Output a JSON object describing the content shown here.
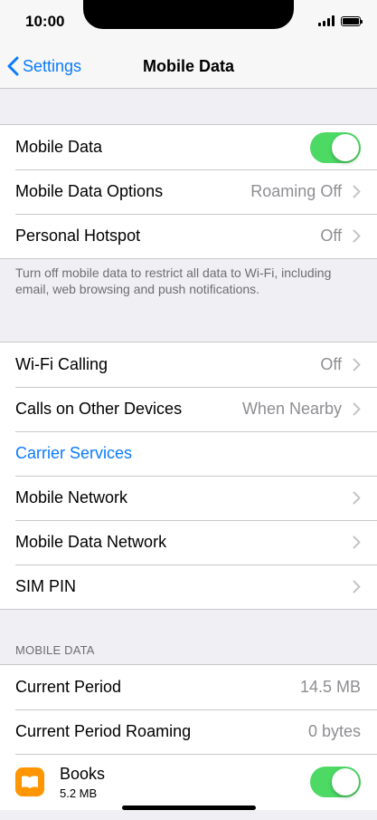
{
  "status_bar": {
    "time": "10:00"
  },
  "nav": {
    "back_label": "Settings",
    "title": "Mobile Data"
  },
  "group1": {
    "mobile_data_label": "Mobile Data",
    "mobile_data_on": true,
    "options_label": "Mobile Data Options",
    "options_value": "Roaming Off",
    "hotspot_label": "Personal Hotspot",
    "hotspot_value": "Off"
  },
  "footnote": "Turn off mobile data to restrict all data to Wi-Fi, including email, web browsing and push notifications.",
  "group2": {
    "wifi_calling_label": "Wi-Fi Calling",
    "wifi_calling_value": "Off",
    "other_devices_label": "Calls on Other Devices",
    "other_devices_value": "When Nearby",
    "carrier_services_label": "Carrier Services",
    "mobile_network_label": "Mobile Network",
    "mobile_data_network_label": "Mobile Data Network",
    "sim_pin_label": "SIM PIN"
  },
  "usage_section": {
    "header": "MOBILE DATA",
    "current_period_label": "Current Period",
    "current_period_value": "14.5 MB",
    "roaming_label": "Current Period Roaming",
    "roaming_value": "0 bytes",
    "apps": [
      {
        "name": "Books",
        "size": "5.2 MB",
        "enabled": true,
        "icon": "books-icon"
      }
    ]
  },
  "colors": {
    "accent": "#0a7aff",
    "toggle_on": "#4cd964",
    "books_icon": "#ff9500"
  }
}
